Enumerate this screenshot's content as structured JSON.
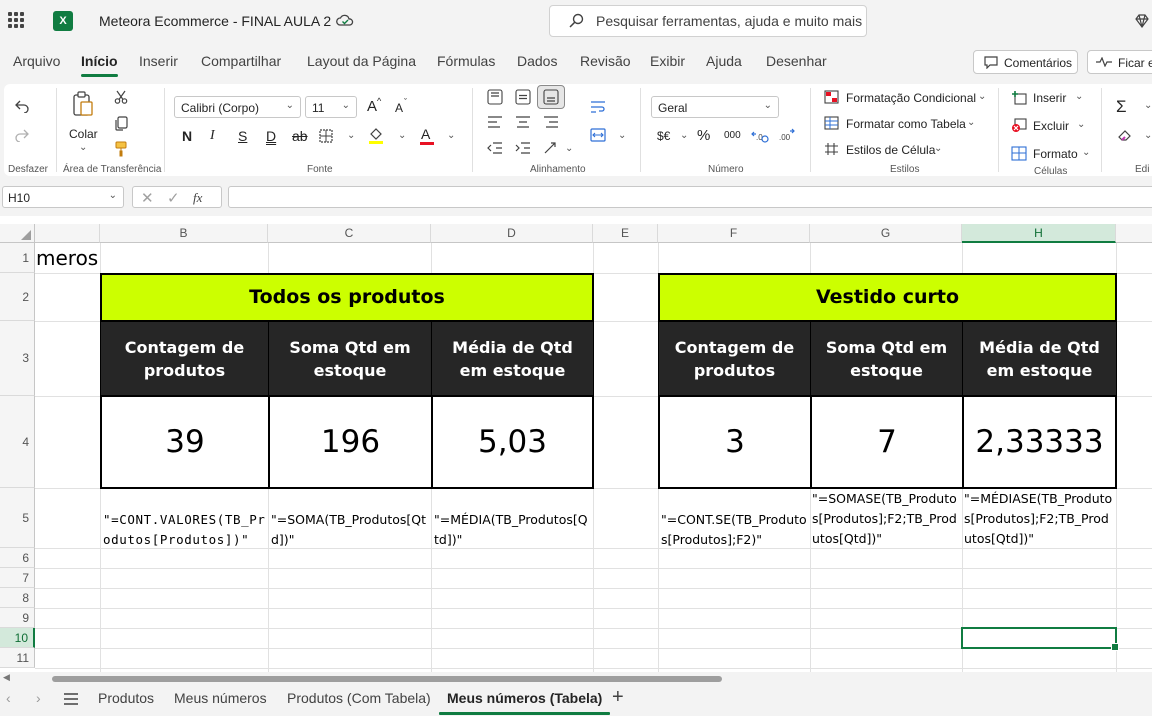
{
  "titlebar": {
    "document_title": "Meteora Ecommerce - FINAL AULA 2",
    "app_logo": "X",
    "search_placeholder": "Pesquisar ferramentas, ajuda e muito mais (A"
  },
  "menu": {
    "tabs": [
      "Arquivo",
      "Início",
      "Inserir",
      "Compartilhar",
      "Layout da Página",
      "Fórmulas",
      "Dados",
      "Revisão",
      "Exibir",
      "Ajuda",
      "Desenhar"
    ],
    "active": "Início",
    "comments_label": "Comentários",
    "catchup_label": "Ficar em"
  },
  "ribbon": {
    "undo_group": "Desfazer",
    "clipboard": {
      "paste_label": "Colar",
      "group": "Área de Transferência"
    },
    "font": {
      "family": "Calibri (Corpo)",
      "size": "11",
      "group": "Fonte",
      "bold": "N",
      "italic": "I",
      "underline": "S",
      "double_underline": "D",
      "strike": "ab",
      "grow": "A",
      "shrink": "A",
      "font_color_letter": "A"
    },
    "alignment": {
      "group": "Alinhamento"
    },
    "number": {
      "format": "Geral",
      "group": "Número",
      "currency": "$€",
      "percent": "%",
      "thousands": "000"
    },
    "styles": {
      "conditional": "Formatação Condicional",
      "as_table": "Formatar como Tabela",
      "cell_styles": "Estilos de Célula",
      "group": "Estilos"
    },
    "cells": {
      "insert": "Inserir",
      "delete": "Excluir",
      "format": "Formato",
      "group": "Células"
    },
    "editing": {
      "sum": "Σ",
      "group": "Edi"
    }
  },
  "formula_bar": {
    "name_box": "H10",
    "fx": "fx",
    "content": ""
  },
  "grid": {
    "columns": [
      "B",
      "C",
      "D",
      "E",
      "F",
      "G",
      "H"
    ],
    "selected_column": "H",
    "rows": [
      "1",
      "2",
      "3",
      "4",
      "5",
      "6",
      "7",
      "8",
      "9",
      "10",
      "11"
    ],
    "selected_row": "10",
    "a1_text": "meros",
    "left_table": {
      "banner": "Todos os produtos",
      "headers": [
        "Contagem de produtos",
        "Soma Qtd em estoque",
        "Média de Qtd em estoque"
      ],
      "values": [
        "39",
        "196",
        "5,03"
      ],
      "formulas": [
        "\"=CONT.VALORES(TB_Produtos[Produtos])\"",
        "\"=SOMA(TB_Produtos[Qtd])\"",
        "\"=MÉDIA(TB_Produtos[Qtd])\""
      ]
    },
    "right_table": {
      "banner": "Vestido curto",
      "headers": [
        "Contagem de produtos",
        "Soma Qtd em estoque",
        "Média de Qtd em estoque"
      ],
      "values": [
        "3",
        "7",
        "2,33333"
      ],
      "formulas": [
        "\"=CONT.SE(TB_Produtos[Produtos];F2)\"",
        "\"=SOMASE(TB_Produtos[Produtos];F2;TB_Produtos[Qtd])\"",
        "\"=MÉDIASE(TB_Produtos[Produtos];F2;TB_Produtos[Qtd])\""
      ]
    }
  },
  "sheets": {
    "tabs": [
      "Produtos",
      "Meus números",
      "Produtos (Com Tabela)",
      "Meus números (Tabela)"
    ],
    "active": "Meus números (Tabela)",
    "add": "+"
  },
  "colors": {
    "accent": "#107c41",
    "banner": "#ccff00",
    "header_fill": "#262626"
  }
}
